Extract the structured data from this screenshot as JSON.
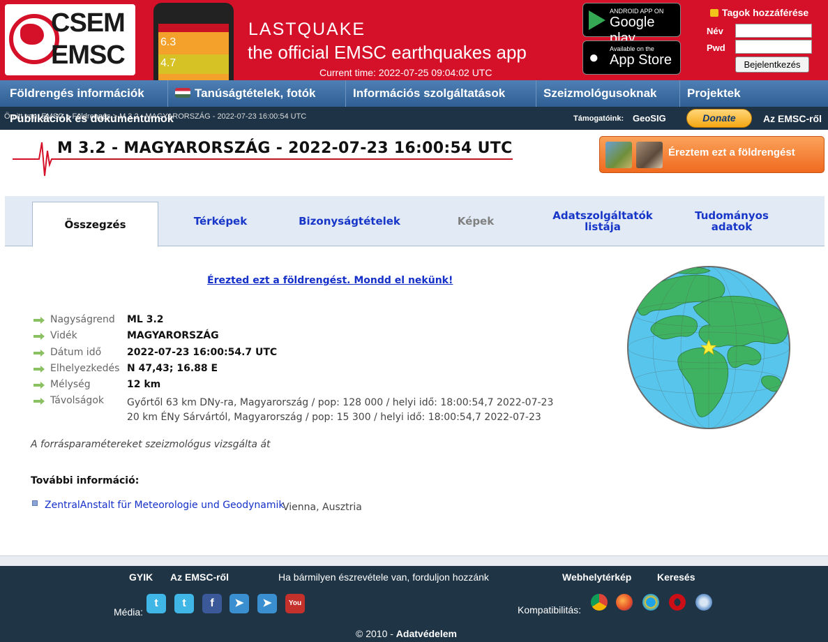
{
  "header": {
    "logo_line1": "CSEM",
    "logo_line2": "EMSC",
    "app_title": "LASTQUAKE",
    "app_subtitle": "the official EMSC earthquakes app",
    "current_time": "Current time: 2022-07-25 09:04:02 UTC",
    "google_play_small": "ANDROID APP ON",
    "google_play_big": "Google play",
    "app_store_small": "Available on the",
    "app_store_big": "App Store",
    "phone_magnitudes": [
      "6.3",
      "4.7"
    ]
  },
  "login": {
    "title": "Tagok hozzáférése",
    "name_label": "Név",
    "pwd_label": "Pwd",
    "name_value": "",
    "pwd_value": "",
    "submit": "Bejelentkezés"
  },
  "nav": {
    "items": [
      "Földrengés információk",
      "Tanúságtételek, fotók",
      "Információs szolgáltatások",
      "Szeizmológusoknak",
      "Projektek"
    ]
  },
  "subnav": {
    "breadcrumb": "Ön itt van: EMSC > Földrengés > M 3.2 - MAGYARORSZÁG - 2022-07-23 16:00:54 UTC",
    "publications": "Publikációk és dokumentumok",
    "sponsors_label": "Támogatóink:",
    "sponsor": "GeoSIG",
    "donate": "Donate",
    "about": "Az EMSC-ről"
  },
  "event": {
    "title": "M 3.2 - MAGYARORSZÁG - 2022-07-23 16:00:54 UTC",
    "felt_button": "Éreztem ezt a földrengést"
  },
  "tabs": [
    {
      "label": "Összegzés",
      "state": "active"
    },
    {
      "label": "Térképek",
      "state": "normal"
    },
    {
      "label": "Bizonyságtételek",
      "state": "normal"
    },
    {
      "label": "Képek",
      "state": "disabled"
    },
    {
      "label": "Adatszolgáltatók listája",
      "state": "normal"
    },
    {
      "label": "Tudományos adatok",
      "state": "normal"
    }
  ],
  "summary": {
    "felt_link": "Érezted ezt a földrengést. Mondd el nekünk!",
    "rows": [
      {
        "key": "Nagyságrend",
        "value": "ML 3.2"
      },
      {
        "key": "Vidék",
        "value": "MAGYARORSZÁG"
      },
      {
        "key": "Dátum idő",
        "value": "2022-07-23 16:00:54.7 UTC"
      },
      {
        "key": "Elhelyezkedés",
        "value": "N 47,43; 16.88 E"
      },
      {
        "key": "Mélység",
        "value": "12 km"
      },
      {
        "key": "Távolságok",
        "value": ""
      }
    ],
    "distances": [
      "Győrtől 63 km DNy-ra, Magyarország / pop: 128 000 / helyi idő: 18:00:54,7 2022-07-23",
      "20 km ÉNy Sárvártól, Magyarország / pop: 15 300 / helyi idő: 18:00:54,7 2022-07-23"
    ],
    "reviewed": "A forrásparamétereket szeizmológus vizsgálta át",
    "more_info_title": "További információ:",
    "agency_link": "ZentralAnstalt für Meteorologie und Geodynamik",
    "agency_location": "Vienna, Ausztria"
  },
  "footer": {
    "faq": "GYIK",
    "about": "Az EMSC-ről",
    "contact": "Ha bármilyen észrevétele van, forduljon hozzánk",
    "sitemap": "Webhelytérkép",
    "search": "Keresés",
    "media_label": "Média:",
    "compat_label": "Kompatibilitás:",
    "copyright_prefix": "© 2010 -",
    "privacy": "Adatvédelem"
  },
  "colors": {
    "header_red": "#d5112a",
    "nav_blue": "#3a6ba1",
    "dark_band": "#1f3445",
    "link_blue": "#1530c9",
    "felt_orange": "#f5822f"
  }
}
